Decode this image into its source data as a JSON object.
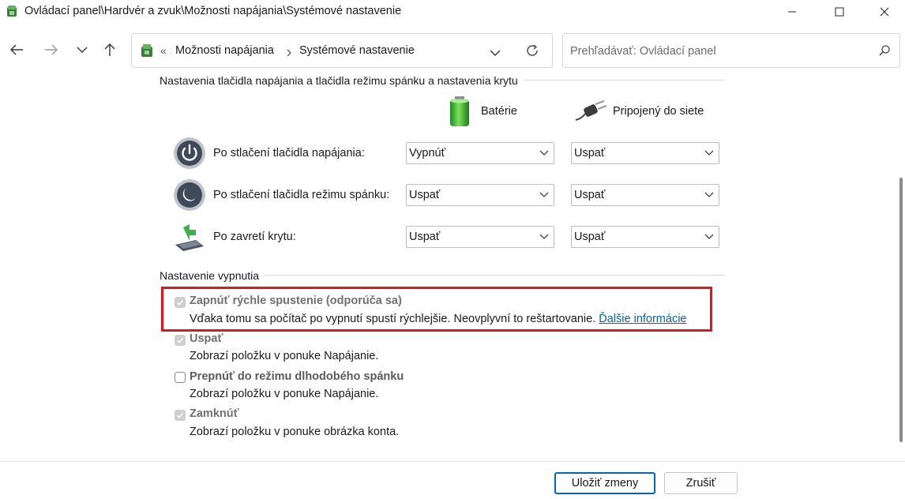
{
  "window": {
    "title": "Ovládací panel\\Hardvér a zvuk\\Možnosti napájania\\Systémové nastavenie"
  },
  "address": {
    "crumb_sep": "«",
    "crumbs": [
      "Možnosti napájania",
      "Systémové nastavenie"
    ]
  },
  "search": {
    "placeholder": "Prehľadávať: Ovládací panel"
  },
  "power_buttons": {
    "group_title": "Nastavenia tlačidla napájania a tlačidla režimu spánku a nastavenia krytu",
    "col_battery": "Batérie",
    "col_plugged": "Pripojený do siete",
    "rows": [
      {
        "label": "Po stlačení tlačidla napájania:",
        "battery": "Vypnúť",
        "plugged": "Uspať"
      },
      {
        "label": "Po stlačení tlačidla režimu spánku:",
        "battery": "Uspať",
        "plugged": "Uspať"
      },
      {
        "label": "Po zavretí krytu:",
        "battery": "Uspať",
        "plugged": "Uspať"
      }
    ]
  },
  "shutdown": {
    "group_title": "Nastavenie vypnutia",
    "options": [
      {
        "title": "Zapnúť rýchle spustenie (odporúča sa)",
        "desc": "Vďaka tomu sa počítač po vypnutí spustí rýchlejšie. Neovplyvní to reštartovanie.",
        "link": "Ďalšie informácie",
        "checked": true
      },
      {
        "title": "Uspať",
        "desc": "Zobrazí položku v ponuke Napájanie.",
        "checked": true
      },
      {
        "title": "Prepnúť do režimu dlhodobého spánku",
        "desc": "Zobrazí položku v ponuke Napájanie.",
        "checked": false
      },
      {
        "title": "Zamknúť",
        "desc": "Zobrazí položku v ponuke obrázka konta.",
        "checked": true
      }
    ]
  },
  "footer": {
    "save": "Uložiť zmeny",
    "cancel": "Zrušiť"
  },
  "colors": {
    "highlight": "#e3141b",
    "link": "#0a5fb4",
    "accent": "#0067c0"
  }
}
